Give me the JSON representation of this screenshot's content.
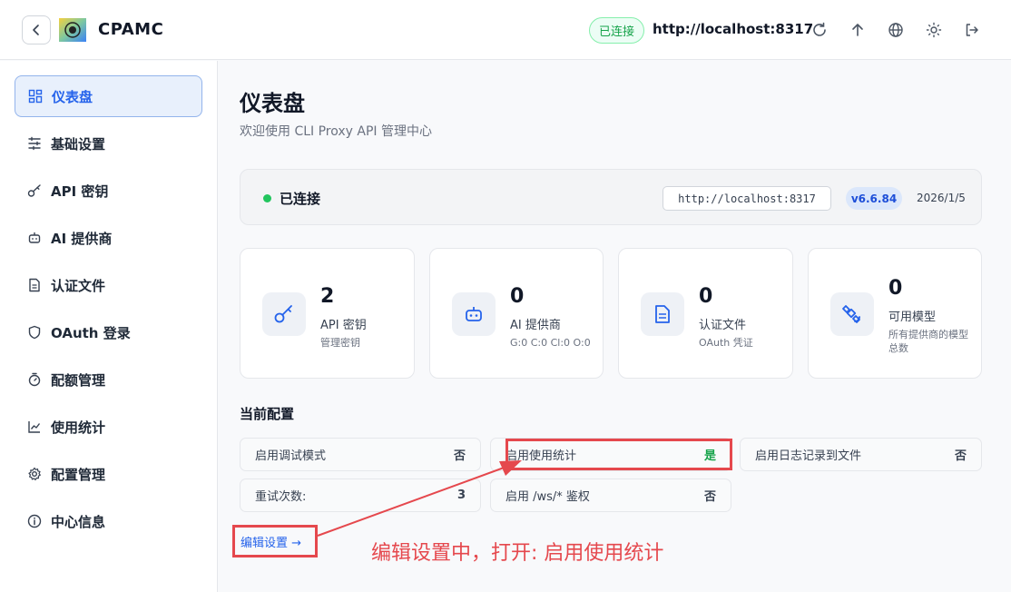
{
  "header": {
    "brand": "CPAMC",
    "connection_status": "已连接",
    "server_url": "http://localhost:8317",
    "icons": [
      "refresh-icon",
      "upload-icon",
      "globe-icon",
      "sun-icon",
      "logout-icon"
    ]
  },
  "sidebar": {
    "items": [
      {
        "label": "仪表盘",
        "icon": "dashboard-icon",
        "active": true
      },
      {
        "label": "基础设置",
        "icon": "sliders-icon"
      },
      {
        "label": "API 密钥",
        "icon": "key-icon"
      },
      {
        "label": "AI 提供商",
        "icon": "robot-icon"
      },
      {
        "label": "认证文件",
        "icon": "file-icon"
      },
      {
        "label": "OAuth 登录",
        "icon": "shield-icon"
      },
      {
        "label": "配额管理",
        "icon": "timer-icon"
      },
      {
        "label": "使用统计",
        "icon": "chart-icon"
      },
      {
        "label": "配置管理",
        "icon": "gear-icon"
      },
      {
        "label": "中心信息",
        "icon": "info-icon"
      }
    ]
  },
  "main": {
    "title": "仪表盘",
    "subtitle": "欢迎使用 CLI Proxy API 管理中心",
    "status": {
      "text": "已连接",
      "url": "http://localhost:8317",
      "version": "v6.6.84",
      "date": "2026/1/5"
    },
    "stats": [
      {
        "value": "2",
        "label": "API 密钥",
        "sub": "管理密钥",
        "icon": "key-icon"
      },
      {
        "value": "0",
        "label": "AI 提供商",
        "sub": "G:0 C:0 Cl:0 O:0",
        "icon": "robot-icon"
      },
      {
        "value": "0",
        "label": "认证文件",
        "sub": "OAuth 凭证",
        "icon": "file-icon"
      },
      {
        "value": "0",
        "label": "可用模型",
        "sub": "所有提供商的模型总数",
        "icon": "satellite-icon"
      }
    ],
    "config_title": "当前配置",
    "config": [
      {
        "label": "启用调试模式",
        "value": "否"
      },
      {
        "label": "启用使用统计",
        "value": "是"
      },
      {
        "label": "启用日志记录到文件",
        "value": "否"
      },
      {
        "label": "重试次数:",
        "value": "3"
      },
      {
        "label": "启用 /ws/* 鉴权",
        "value": "否"
      }
    ],
    "edit_link": "编辑设置 →"
  },
  "annotation": {
    "text": "编辑设置中，打开: 启用使用统计",
    "color": "#e5484d"
  }
}
